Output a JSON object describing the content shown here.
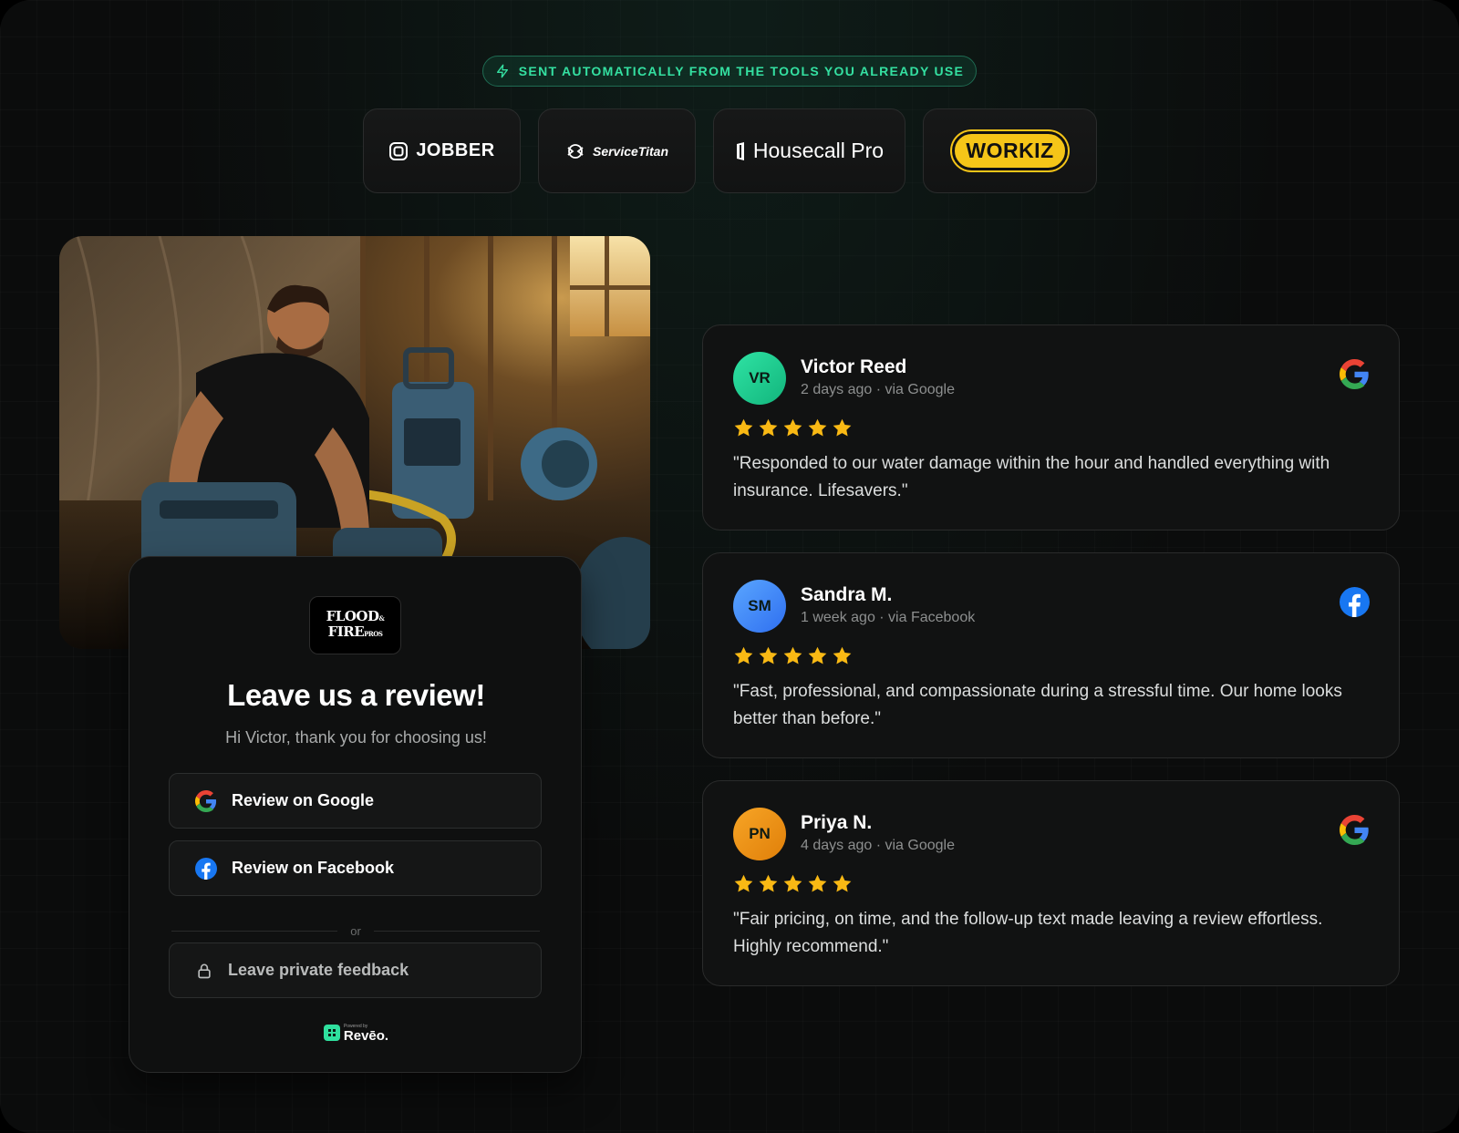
{
  "banner": {
    "text": "SENT AUTOMATICALLY FROM THE TOOLS YOU ALREADY USE",
    "accent": "#34e0a1",
    "icon": "lightning-icon"
  },
  "integrations": [
    {
      "name": "JOBBER"
    },
    {
      "name": "ServiceTitan"
    },
    {
      "name": "Housecall Pro"
    },
    {
      "name": "WORKIZ"
    }
  ],
  "review_request": {
    "brand_logo_text": {
      "line1": "FLOOD",
      "amp": "&",
      "line2": "FIRE",
      "small": "PROS"
    },
    "title": "Leave us a review!",
    "subtitle": "Hi Victor, thank you for choosing us!",
    "google_button": "Review on Google",
    "facebook_button": "Review on Facebook",
    "divider": "or",
    "private_button": "Leave private feedback",
    "powered_by_small": "Powered by",
    "powered_by_name": "Revēo."
  },
  "reviews": [
    {
      "initials": "VR",
      "name": "Victor Reed",
      "meta": "2 days ago · via Google",
      "platform": "google",
      "rating": 5,
      "quote": "\"Responded to our water damage within the hour and handled everything with insurance. Lifesavers.\"",
      "avatar_from": "#2fe3a4",
      "avatar_to": "#12b57c"
    },
    {
      "initials": "SM",
      "name": "Sandra M.",
      "meta": "1 week ago · via Facebook",
      "platform": "facebook",
      "rating": 5,
      "quote": "\"Fast, professional, and compassionate during a stressful time. Our home looks better than before.\"",
      "avatar_from": "#5aa6ff",
      "avatar_to": "#2f6ff0"
    },
    {
      "initials": "PN",
      "name": "Priya N.",
      "meta": "4 days ago · via Google",
      "platform": "google",
      "rating": 5,
      "quote": "\"Fair pricing, on time, and the follow-up text made leaving a review effortless. Highly recommend.\"",
      "avatar_from": "#f7a526",
      "avatar_to": "#e07f09"
    }
  ],
  "colors": {
    "star": "#f9b914",
    "google_blue": "#4285F4",
    "google_red": "#EA4335",
    "google_yellow": "#FBBC05",
    "google_green": "#34A853",
    "facebook_blue": "#1877F2"
  }
}
